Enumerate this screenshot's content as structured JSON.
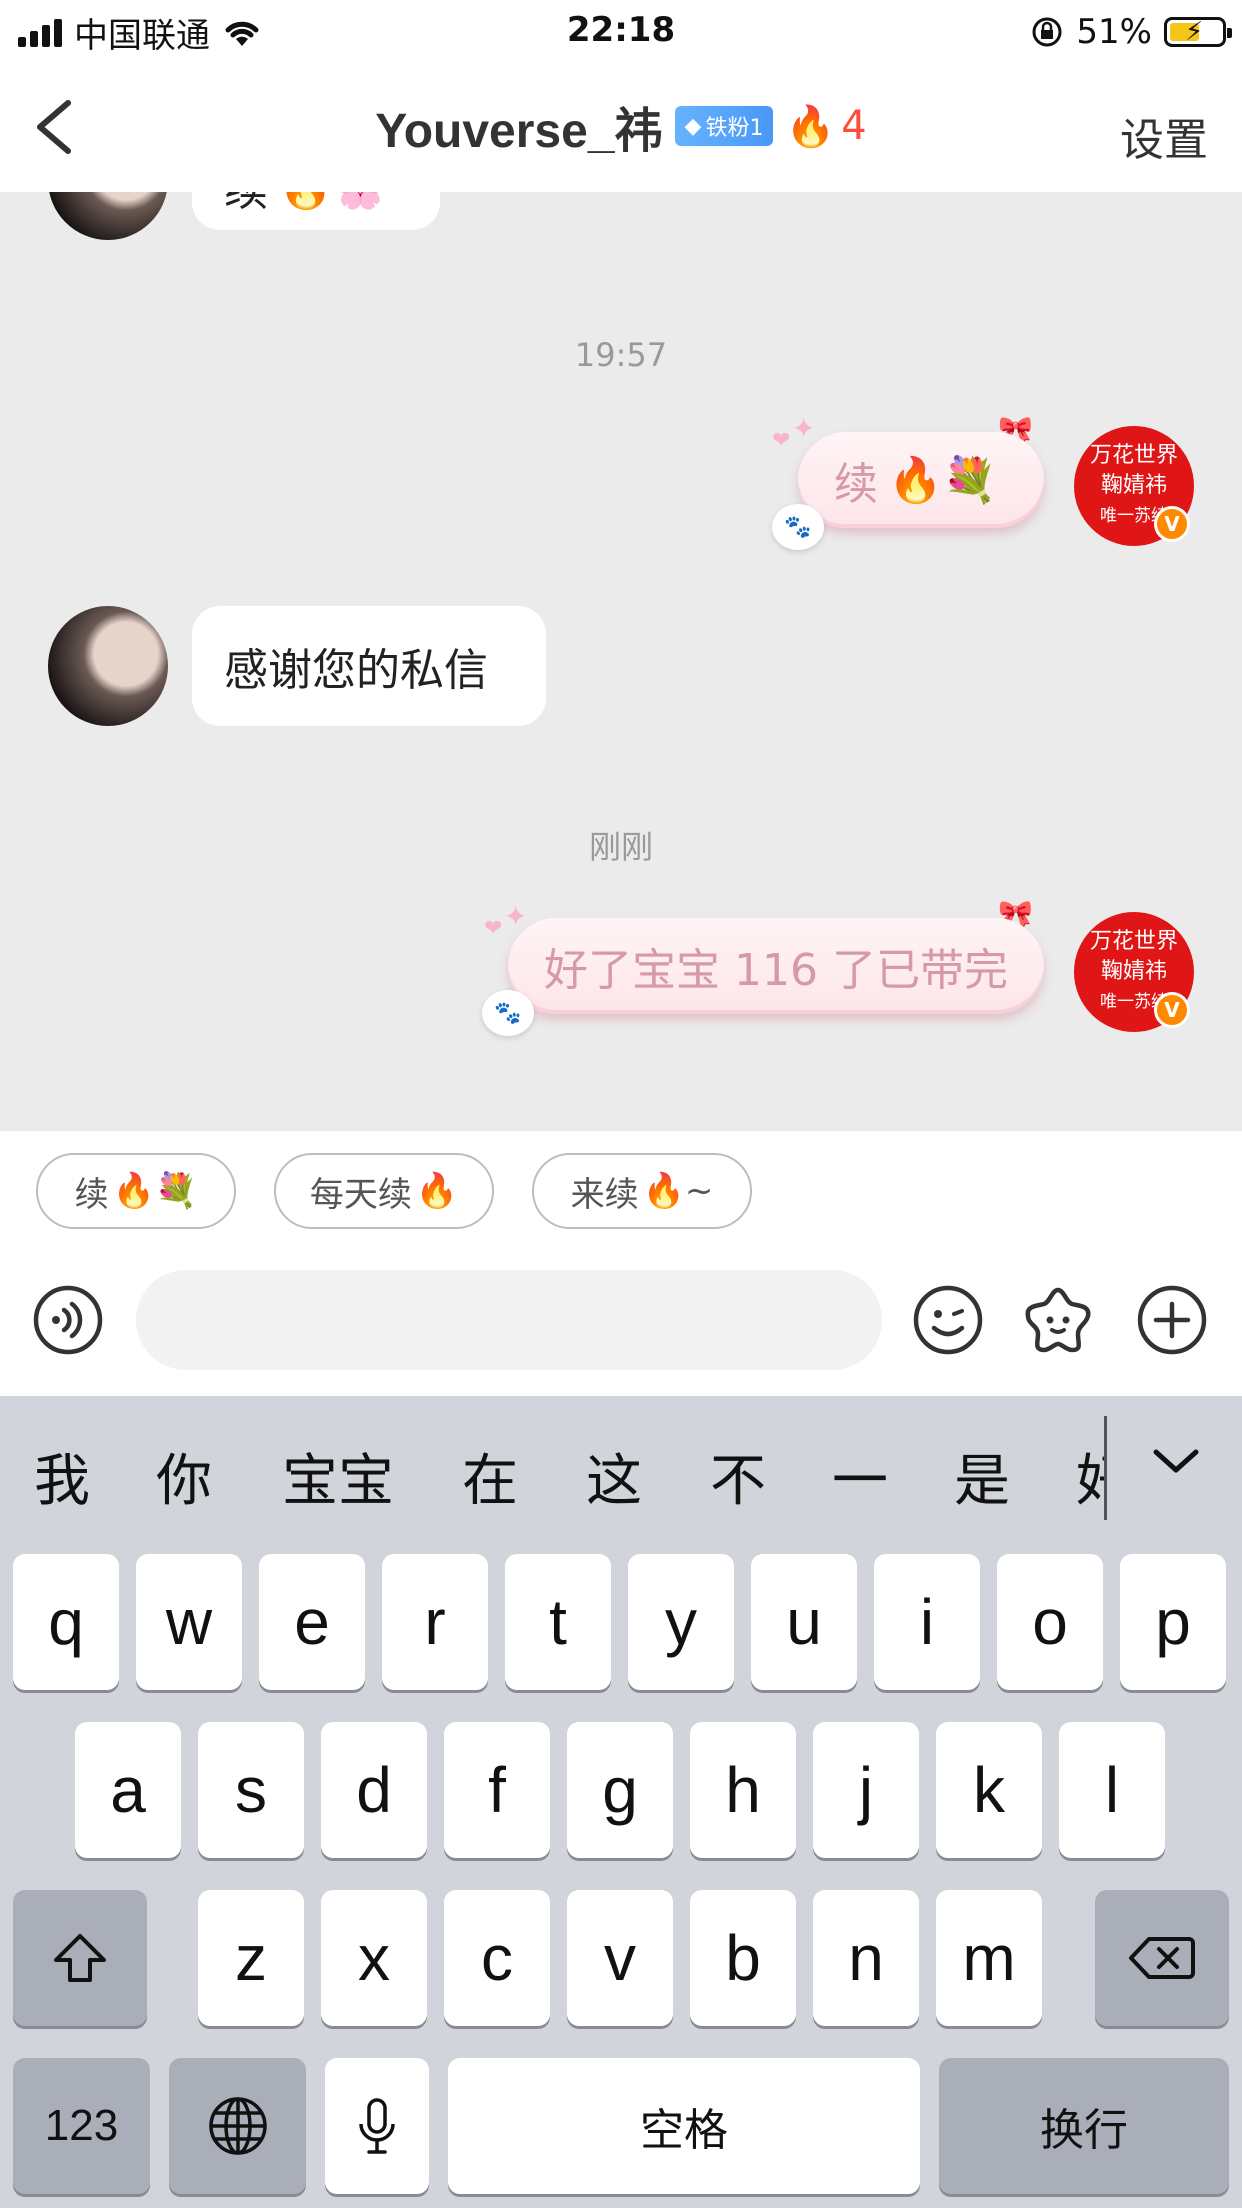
{
  "status_bar": {
    "carrier": "中国联通",
    "time": "22:18",
    "battery_pct": "51%",
    "battery_level": 0.51
  },
  "nav": {
    "title": "Youverse_祎",
    "fan_badge": "铁粉1",
    "fire_count": "4",
    "settings_label": "设置"
  },
  "chat": {
    "messages": [
      {
        "side": "left",
        "text": "续"
      },
      {
        "side": "time",
        "text": "19:57"
      },
      {
        "side": "right",
        "text": "续",
        "emoji": "🔥💐"
      },
      {
        "side": "left",
        "text": "感谢您的私信"
      },
      {
        "side": "time",
        "text": "刚刚"
      },
      {
        "side": "right",
        "text": "好了宝宝 116 了已带完"
      }
    ],
    "my_avatar": {
      "line1": "万花世界",
      "line2": "鞠婧祎",
      "line3": "唯一苏绮",
      "badge": "V"
    }
  },
  "quick_replies": [
    {
      "text": "续",
      "emoji": "🔥💐"
    },
    {
      "text": "每天续",
      "emoji": "🔥"
    },
    {
      "text": "来续",
      "emoji": "🔥~"
    }
  ],
  "input": {
    "placeholder": ""
  },
  "keyboard": {
    "candidates": [
      "我",
      "你",
      "宝宝",
      "在",
      "这",
      "不",
      "一",
      "是",
      "好"
    ],
    "row1": [
      "q",
      "w",
      "e",
      "r",
      "t",
      "y",
      "u",
      "i",
      "o",
      "p"
    ],
    "row2": [
      "a",
      "s",
      "d",
      "f",
      "g",
      "h",
      "j",
      "k",
      "l"
    ],
    "row3": [
      "z",
      "x",
      "c",
      "v",
      "b",
      "n",
      "m"
    ],
    "num_label": "123",
    "space_label": "空格",
    "return_label": "换行"
  },
  "colors": {
    "accent_red": "#e01515",
    "fire": "#ff4b3a",
    "bubble_pink": "#d69aa6",
    "badge_blue": "#4a98f7"
  }
}
